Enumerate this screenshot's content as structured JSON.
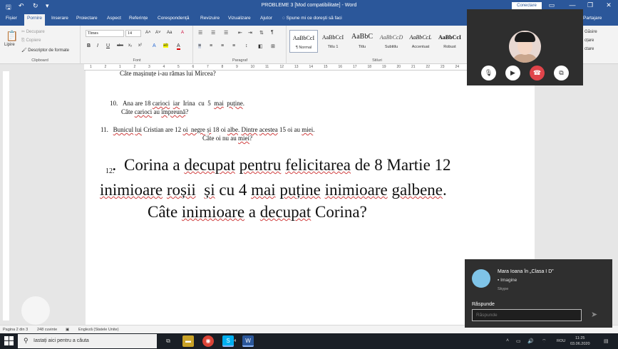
{
  "window": {
    "title": "PROBLEME 3 [Mod compatibilitate] - Word",
    "signin_label": "Conectare",
    "controls": {
      "minimize": "—",
      "restore": "❐",
      "close": "✕",
      "options": "▭"
    }
  },
  "quick_access": {
    "save": "🖫",
    "undo": "↶",
    "redo": "↻",
    "customize": "▾"
  },
  "tabs": [
    "Fișier",
    "Pornire",
    "Inserare",
    "Proiectare",
    "Aspect",
    "Referințe",
    "Corespondență",
    "Revizuire",
    "Vizualizare",
    "Ajutor"
  ],
  "active_tab": "Pornire",
  "tell_me": "Spune mi ce doreşti să faci",
  "share_label": "Partajare",
  "ribbon": {
    "clipboard": {
      "paste": "Lipire",
      "cut": "Decupare",
      "copy": "Copiere",
      "format_painter": "Descriptor de formate",
      "label": "Clipboard"
    },
    "font": {
      "name": "Times",
      "size": "14",
      "label": "Font",
      "bold": "B",
      "italic": "I",
      "underline": "U",
      "strike": "abc",
      "sub": "x₂",
      "sup": "x²",
      "grow": "A˄",
      "shrink": "A˅",
      "case": "Aa",
      "clear": "A",
      "effects": "A",
      "highlight": "ab",
      "color": "A"
    },
    "paragraph": {
      "label": "Paragraf"
    },
    "styles": {
      "label": "Stiluri",
      "items": [
        {
          "sample": "AaBbCcI",
          "name": "¶ Normal"
        },
        {
          "sample": "AaBbCcI",
          "name": "Titlu 1"
        },
        {
          "sample": "AaBbC",
          "name": "Titlu"
        },
        {
          "sample": "AaBbCcD",
          "name": "Subtitlu"
        },
        {
          "sample": "AaBbCcL",
          "name": "Accentuat"
        },
        {
          "sample": "AaBbCcI",
          "name": "Robust"
        },
        {
          "sample": "AaBbCcI",
          "name": ""
        }
      ]
    },
    "editing": {
      "find": "Găsire",
      "replace": "cțare",
      "select": "ctare"
    }
  },
  "ruler_numbers": [
    "1",
    "2",
    "1",
    "2",
    "3",
    "4",
    "5",
    "6",
    "7",
    "8",
    "9",
    "10",
    "11",
    "12",
    "13",
    "14",
    "15",
    "16",
    "17",
    "18",
    "19",
    "20",
    "21",
    "22",
    "23",
    "24",
    "25",
    "26",
    "27",
    "28",
    "29"
  ],
  "document": {
    "top_cut": "Câte mașinuțe i-au rămas lui Mircea?",
    "p10_line1": "10.   Ana are 18 carioci  iar  Irina  cu  5  mai  puține.",
    "p10_line2": "Câte carioci au împreună?",
    "p11_line1": "11.   Bunicul lui Cristian are 12 oi  negre și 18 oi albe. Dintre acestea 15 oi au miei.",
    "p11_line2": "Câte oi nu au miei?",
    "p12_num": "12.",
    "p12_line1": "  Corina a decupat pentru felicitarea de 8 Martie 12",
    "p12_line2": "inimioare roșii  și cu 4 mai puține inimioare galbene.",
    "p12_line3": "Câte inimioare a decupat Corina?"
  },
  "statusbar": {
    "page": "Pagina 2 din 3",
    "words": "248 cuvinte",
    "lang": "Engleză (Statele Unite)"
  },
  "taskbar": {
    "search_placeholder": "Iastați aici pentru a căuta",
    "skype_badge": "4",
    "lang": "ROU",
    "time": "11:25",
    "date": "03.06.2020"
  },
  "call": {
    "mic": "🎙",
    "video": "▶",
    "hangup": "☎",
    "screen": "⧉"
  },
  "notification": {
    "sender": "Mara Ioana în „Clasa I D”",
    "message": "Imagine",
    "app": "Skype",
    "reply_label": "Răspunde",
    "reply_placeholder": "Răspunde",
    "send": "➤"
  },
  "colors": {
    "word_blue": "#2b579a",
    "hangup_red": "#e0444a"
  }
}
